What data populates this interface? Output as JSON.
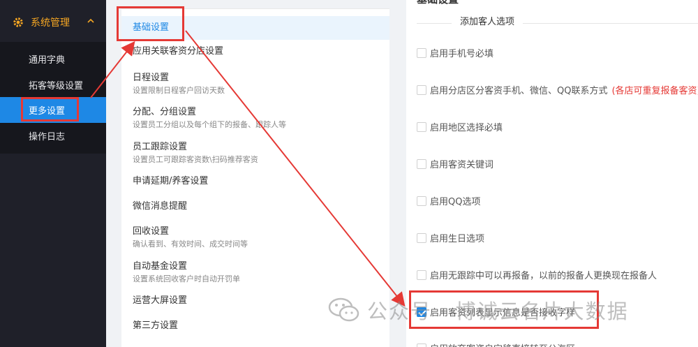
{
  "sidebar": {
    "parent": {
      "label": "系统管理",
      "icon": "gear-icon",
      "expand_icon": "chevron-up-icon"
    },
    "items": [
      {
        "label": "通用字典"
      },
      {
        "label": "拓客等级设置"
      },
      {
        "label": "更多设置",
        "active": true
      },
      {
        "label": "操作日志"
      }
    ]
  },
  "menu": {
    "items": [
      {
        "title": "基础设置",
        "desc": "",
        "active": true
      },
      {
        "title": "应用关联客资分店设置",
        "desc": ""
      },
      {
        "title": "日程设置",
        "desc": "设置限制日程客户回访天数"
      },
      {
        "title": "分配、分组设置",
        "desc": "设置员工分组以及每个组下的报备、跟踪人等"
      },
      {
        "title": "员工跟踪设置",
        "desc": "设置员工可跟踪客资数\\扫码推荐客资"
      },
      {
        "title": "申请延期/养客设置",
        "desc": ""
      },
      {
        "title": "微信消息提醒",
        "desc": ""
      },
      {
        "title": "回收设置",
        "desc": "确认看到、有效时间、成交时间等"
      },
      {
        "title": "自动基金设置",
        "desc": "设置系统回收客户时自动开罚单"
      },
      {
        "title": "运营大屏设置",
        "desc": ""
      },
      {
        "title": "第三方设置",
        "desc": ""
      }
    ]
  },
  "settings": {
    "header_partial": "基础设置",
    "section_title": "添加客人选项",
    "options": [
      {
        "label": "启用手机号必填",
        "checked": false
      },
      {
        "label": "启用分店区分客资手机、微信、QQ联系方式",
        "note": "(各店可重复报备客资)",
        "checked": false
      },
      {
        "label": "启用地区选择必填",
        "checked": false
      },
      {
        "label": "启用客资关键词",
        "checked": false
      },
      {
        "label": "启用QQ选项",
        "checked": false
      },
      {
        "label": "启用生日选项",
        "checked": false
      },
      {
        "label": "启用无跟踪中可以再报备，以前的报备人更换现在报备人",
        "checked": false
      },
      {
        "label": "启用客资列表显示信息是否接收字样",
        "checked": true
      },
      {
        "label": "启用放弃客资自定移直接转至公海区",
        "checked": false
      }
    ]
  },
  "watermark": {
    "text": "公众号 · 博诚云名片大数据",
    "icon": "wechat-icon"
  },
  "annotation_color": "#e53935",
  "accent_color": "#1e88e5"
}
